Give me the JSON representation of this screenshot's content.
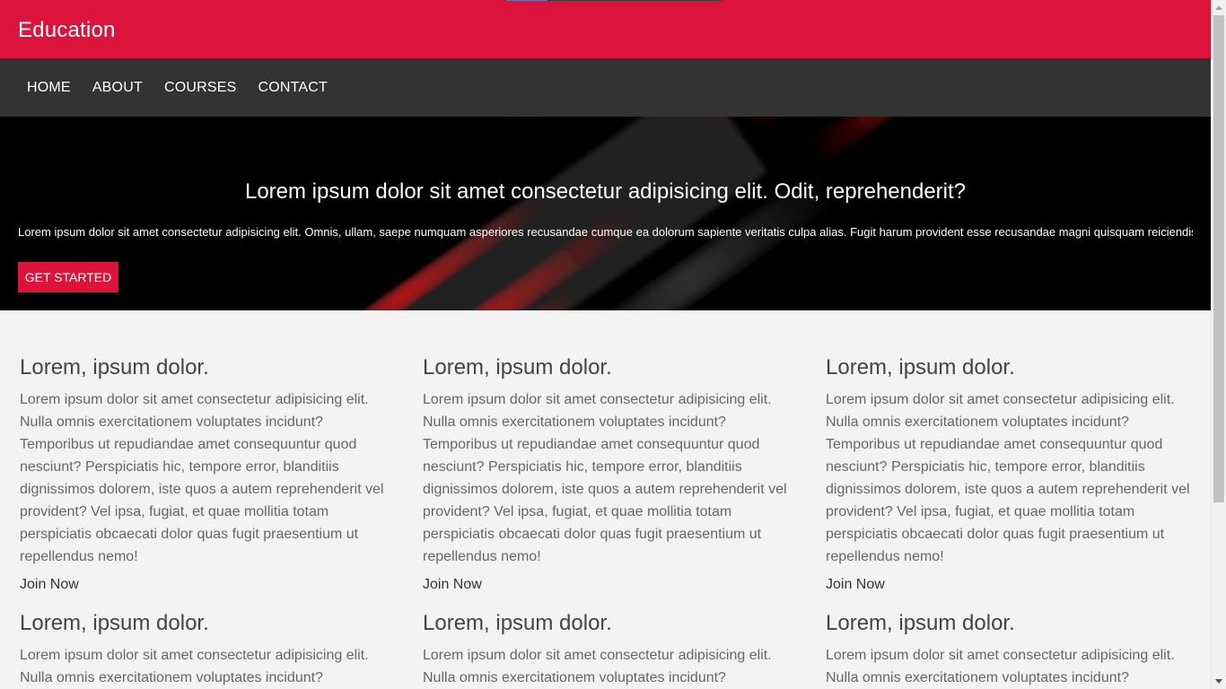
{
  "header": {
    "brand": "Education"
  },
  "nav": {
    "items": [
      "HOME",
      "ABOUT",
      "COURSES",
      "CONTACT"
    ]
  },
  "hero": {
    "title": "Lorem ipsum dolor sit amet consectetur adipisicing elit. Odit, reprehenderit?",
    "text": "Lorem ipsum dolor sit amet consectetur adipisicing elit. Omnis, ullam, saepe numquam asperiores recusandae cumque ea dolorum sapiente veritatis culpa alias. Fugit harum provident esse recusandae magni quisquam reiciendis omnis?",
    "button": "GET STARTED"
  },
  "cards": [
    {
      "title": "Lorem, ipsum dolor.",
      "text": "Lorem ipsum dolor sit amet consectetur adipisicing elit. Nulla omnis exercitationem voluptates incidunt? Temporibus ut repudiandae amet consequuntur quod nesciunt? Perspiciatis hic, tempore error, blanditiis dignissimos dolorem, iste quos a autem reprehenderit vel provident? Vel ipsa, fugiat, et quae mollitia totam perspiciatis obcaecati dolor quas fugit praesentium ut repellendus nemo!",
      "link": "Join Now"
    },
    {
      "title": "Lorem, ipsum dolor.",
      "text": "Lorem ipsum dolor sit amet consectetur adipisicing elit. Nulla omnis exercitationem voluptates incidunt? Temporibus ut repudiandae amet consequuntur quod nesciunt? Perspiciatis hic, tempore error, blanditiis dignissimos dolorem, iste quos a autem reprehenderit vel provident? Vel ipsa, fugiat, et quae mollitia totam perspiciatis obcaecati dolor quas fugit praesentium ut repellendus nemo!",
      "link": "Join Now"
    },
    {
      "title": "Lorem, ipsum dolor.",
      "text": "Lorem ipsum dolor sit amet consectetur adipisicing elit. Nulla omnis exercitationem voluptates incidunt? Temporibus ut repudiandae amet consequuntur quod nesciunt? Perspiciatis hic, tempore error, blanditiis dignissimos dolorem, iste quos a autem reprehenderit vel provident? Vel ipsa, fugiat, et quae mollitia totam perspiciatis obcaecati dolor quas fugit praesentium ut repellendus nemo!",
      "link": "Join Now"
    },
    {
      "title": "Lorem, ipsum dolor.",
      "text": "Lorem ipsum dolor sit amet consectetur adipisicing elit. Nulla omnis exercitationem voluptates incidunt? Temporibus ut",
      "link": ""
    },
    {
      "title": "Lorem, ipsum dolor.",
      "text": "Lorem ipsum dolor sit amet consectetur adipisicing elit. Nulla omnis exercitationem voluptates incidunt? Temporibus ut",
      "link": ""
    },
    {
      "title": "Lorem, ipsum dolor.",
      "text": "Lorem ipsum dolor sit amet consectetur adipisicing elit. Nulla omnis exercitationem voluptates incidunt? Temporibus ut",
      "link": ""
    }
  ],
  "colors": {
    "brand": "#dc143c",
    "nav": "#333333",
    "hero_bg": "#000000",
    "page_bg": "#f3f3f3"
  }
}
